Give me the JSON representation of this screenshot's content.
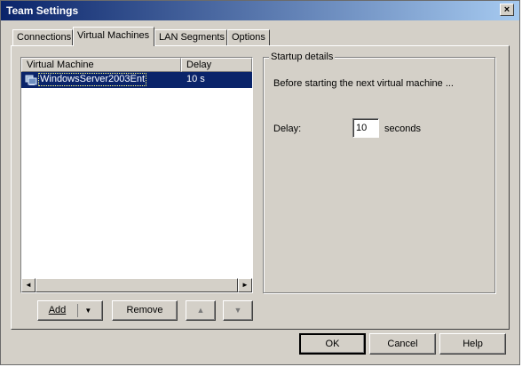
{
  "window": {
    "title": "Team Settings",
    "close_glyph": "×"
  },
  "tabs": [
    {
      "label": "Connections"
    },
    {
      "label": "Virtual Machines",
      "active": true
    },
    {
      "label": "LAN Segments"
    },
    {
      "label": "Options"
    }
  ],
  "vm_list": {
    "columns": [
      "Virtual Machine",
      "Delay"
    ],
    "rows": [
      {
        "name": "WindowsServer2003Ent",
        "delay": "10 s",
        "selected": true,
        "icon": "virtual-machine-icon"
      }
    ],
    "scroll_left": "◄",
    "scroll_right": "►"
  },
  "list_buttons": {
    "add": "Add",
    "add_arrow": "▼",
    "remove": "Remove",
    "up": "▲",
    "down": "▼"
  },
  "startup": {
    "group_title": "Startup details",
    "description": "Before starting the next virtual machine ...",
    "delay_label": "Delay:",
    "delay_value": "10",
    "units": "seconds"
  },
  "footer": {
    "ok": "OK",
    "cancel": "Cancel",
    "help": "Help"
  },
  "colors": {
    "selection": "#0a246a",
    "face": "#d4d0c8",
    "title_start": "#0a246a",
    "title_end": "#a6caf0"
  }
}
